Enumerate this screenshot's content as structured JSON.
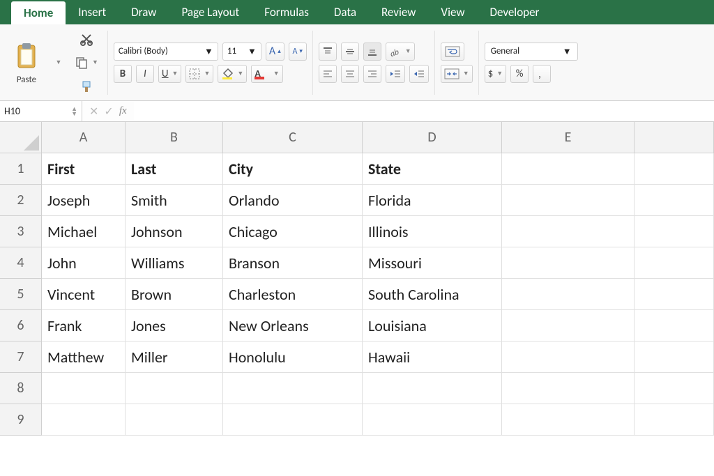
{
  "ribbon": {
    "tabs": [
      "Home",
      "Insert",
      "Draw",
      "Page Layout",
      "Formulas",
      "Data",
      "Review",
      "View",
      "Developer"
    ],
    "active_tab_index": 0
  },
  "clipboard": {
    "paste_label": "Paste"
  },
  "font": {
    "name": "Calibri (Body)",
    "size": "11",
    "bold": "B",
    "italic": "I",
    "underline": "U",
    "increase": "A",
    "decrease": "A"
  },
  "number_format": {
    "selected": "General",
    "currency": "$",
    "percent": "%"
  },
  "namebox": {
    "ref": "H10"
  },
  "formula": {
    "fx_label": "fx",
    "value": ""
  },
  "sheet": {
    "columns": [
      "A",
      "B",
      "C",
      "D",
      "E",
      ""
    ],
    "row_numbers": [
      "1",
      "2",
      "3",
      "4",
      "5",
      "6",
      "7",
      "8",
      "9"
    ],
    "headers": [
      "First",
      "Last",
      "City",
      "State"
    ],
    "rows": [
      [
        "Joseph",
        "Smith",
        "Orlando",
        "Florida"
      ],
      [
        "Michael",
        "Johnson",
        "Chicago",
        "Illinois"
      ],
      [
        "John",
        "Williams",
        "Branson",
        "Missouri"
      ],
      [
        "Vincent",
        "Brown",
        "Charleston",
        "South Carolina"
      ],
      [
        "Frank",
        "Jones",
        "New Orleans",
        "Louisiana"
      ],
      [
        "Matthew",
        "Miller",
        "Honolulu",
        "Hawaii"
      ]
    ]
  },
  "chart_data": {
    "type": "table",
    "title": "",
    "columns": [
      "First",
      "Last",
      "City",
      "State"
    ],
    "rows": [
      [
        "Joseph",
        "Smith",
        "Orlando",
        "Florida"
      ],
      [
        "Michael",
        "Johnson",
        "Chicago",
        "Illinois"
      ],
      [
        "John",
        "Williams",
        "Branson",
        "Missouri"
      ],
      [
        "Vincent",
        "Brown",
        "Charleston",
        "South Carolina"
      ],
      [
        "Frank",
        "Jones",
        "New Orleans",
        "Louisiana"
      ],
      [
        "Matthew",
        "Miller",
        "Honolulu",
        "Hawaii"
      ]
    ]
  }
}
